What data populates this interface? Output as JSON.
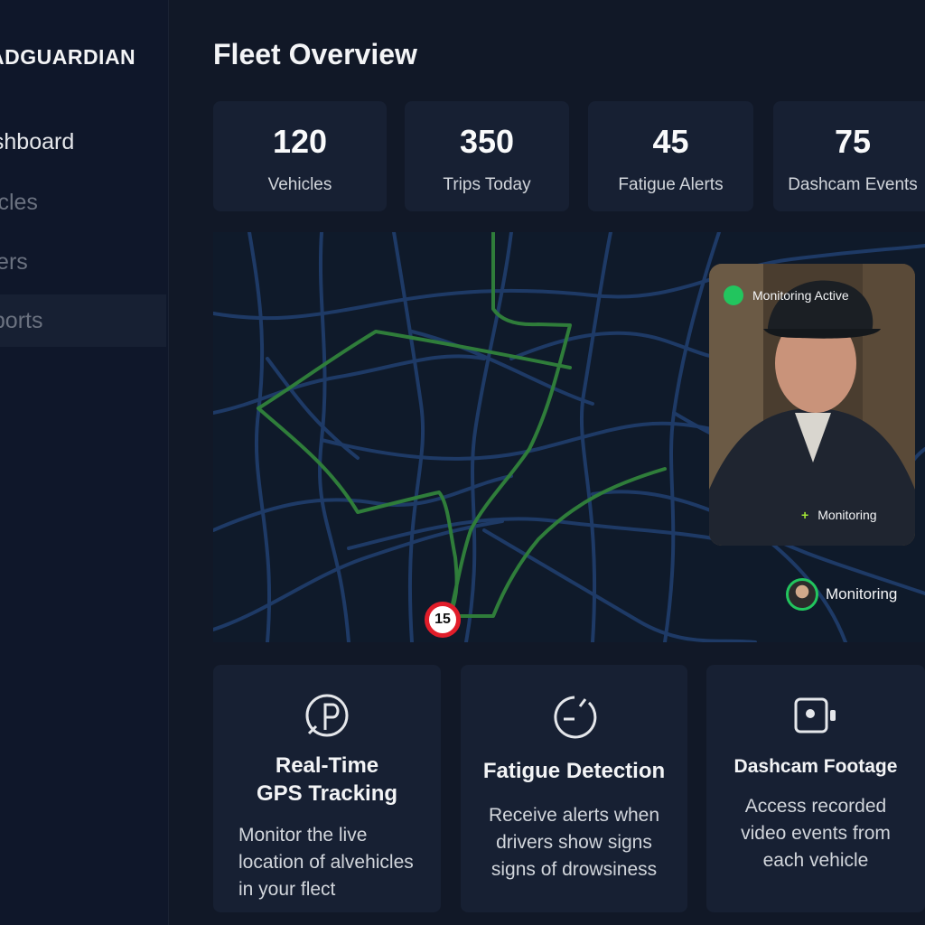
{
  "app": {
    "brand": "ADGUARDIAN"
  },
  "sidebar": {
    "items": [
      {
        "label": "oshboard"
      },
      {
        "label": "hicles"
      },
      {
        "label": "ivers"
      },
      {
        "label": "eports"
      }
    ]
  },
  "header": {
    "title": "Fleet Overview"
  },
  "stats": [
    {
      "value": "120",
      "label": "Vehicles"
    },
    {
      "value": "350",
      "label": "Trips Today"
    },
    {
      "value": "45",
      "label": "Fatigue Alerts"
    },
    {
      "value": "75",
      "label": "Dashcam Events"
    }
  ],
  "map": {
    "speed_limit": "15",
    "route_color": "#2f7d3a",
    "road_color": "#1e3a66"
  },
  "camera": {
    "status": "Monitoring Active",
    "footer": "Monitoring",
    "badge": "Monitoring"
  },
  "features": [
    {
      "icon": "gps-pin-icon",
      "title_lines": [
        "Real-Time",
        "GPS Tracking"
      ],
      "desc_lines": [
        "Monitor the live",
        "location of alvehicles",
        "in your flect"
      ]
    },
    {
      "icon": "gauge-icon",
      "title_lines": [
        "Fatigue Detection"
      ],
      "desc_lines": [
        "Receive alerts when",
        "drivers show signs",
        "signs of drowsiness"
      ]
    },
    {
      "icon": "dashcam-icon",
      "title_lines": [
        "Dashcam Footage"
      ],
      "desc_lines": [
        "Access recorded",
        "video events from",
        "each vehicle"
      ]
    }
  ]
}
